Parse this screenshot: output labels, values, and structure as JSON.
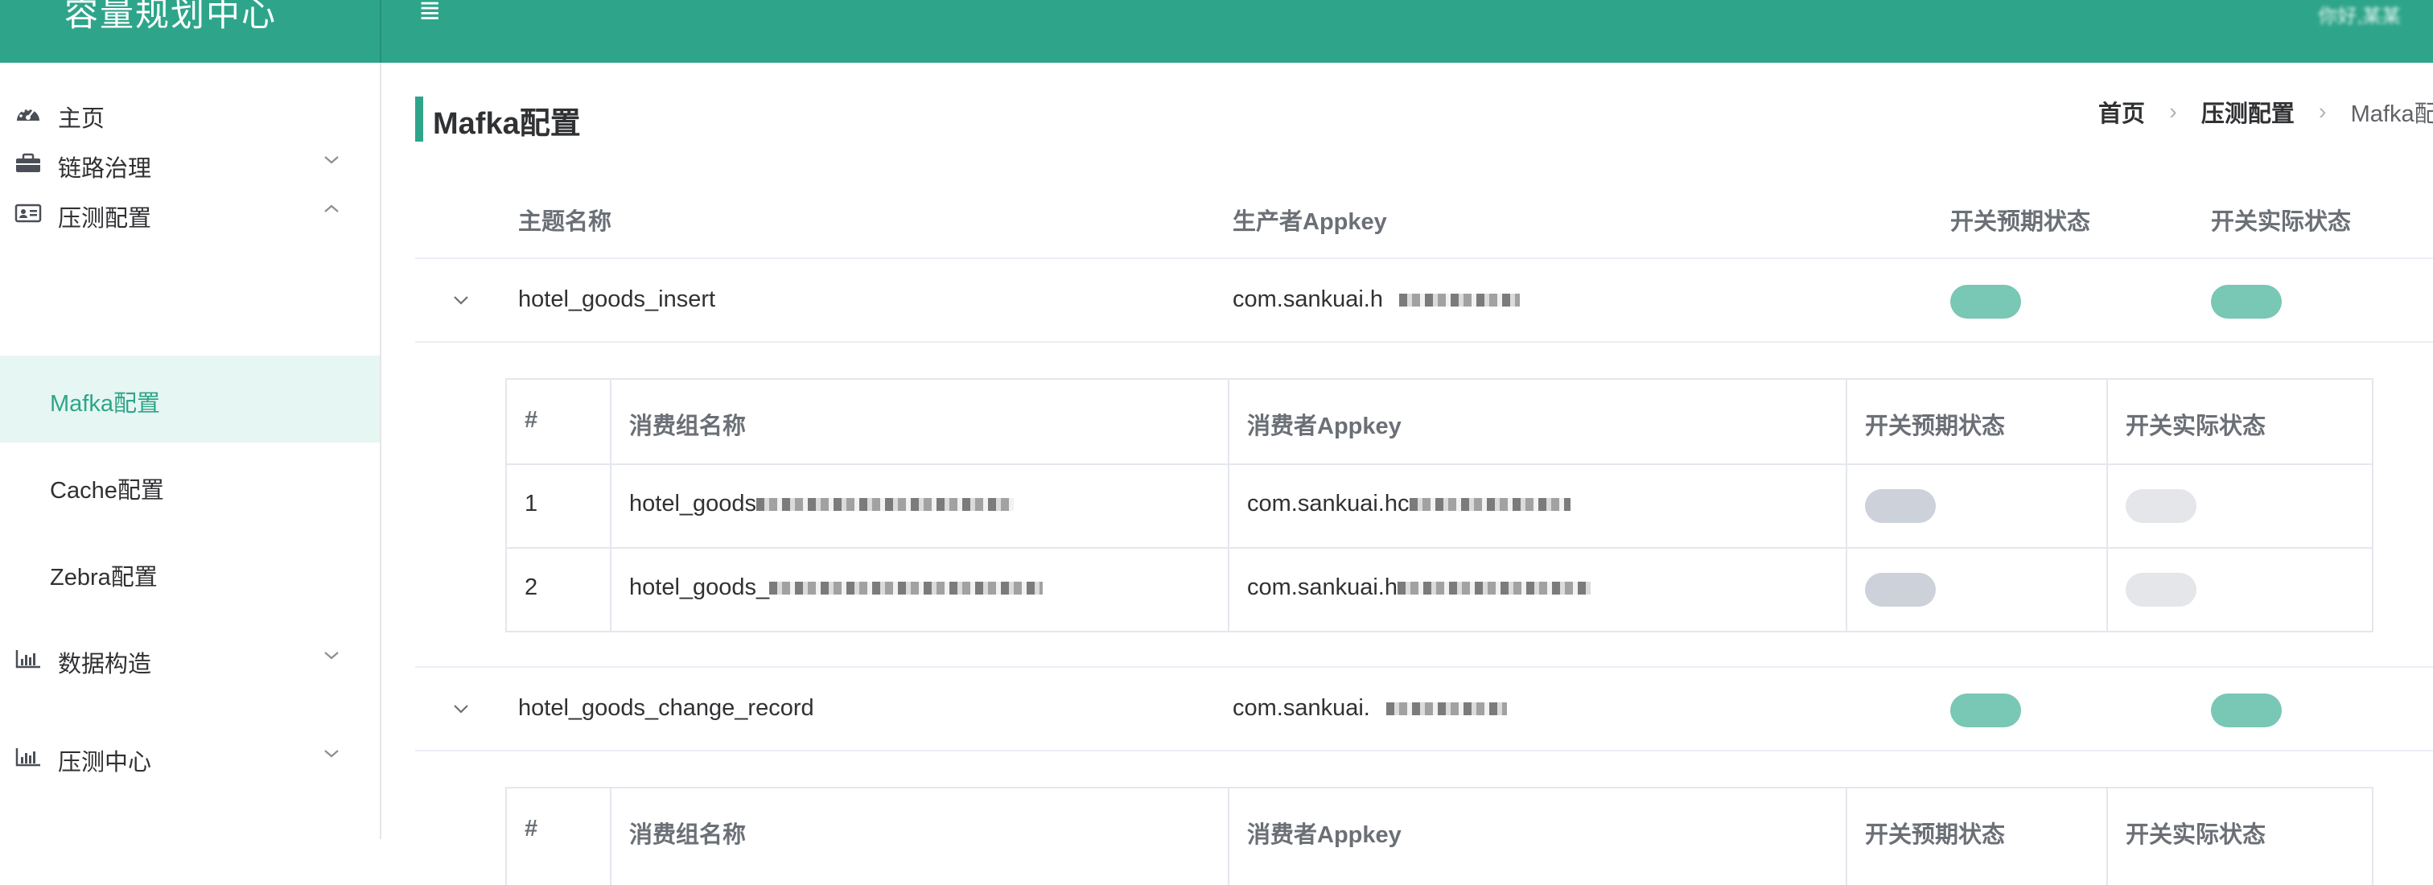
{
  "app": {
    "title": "容量规划中心",
    "menu_icon": "menu-icon",
    "user_name": "你好,某某"
  },
  "sidebar": {
    "items": [
      {
        "label": "主页",
        "icon": "dashboard-icon"
      },
      {
        "label": "链路治理",
        "icon": "briefcase-icon",
        "expanded": false
      },
      {
        "label": "压测配置",
        "icon": "id-card-icon",
        "expanded": true
      },
      {
        "label": "数据构造",
        "icon": "bar-chart-icon",
        "expanded": false
      },
      {
        "label": "压测中心",
        "icon": "bar-chart-icon",
        "expanded": false
      }
    ],
    "sub_items": [
      {
        "label": "Mafka配置",
        "active": true
      },
      {
        "label": "Cache配置",
        "active": false
      },
      {
        "label": "Zebra配置",
        "active": false
      }
    ]
  },
  "page": {
    "title": "Mafka配置"
  },
  "breadcrumb": [
    "首页",
    "压测配置",
    "Mafka配"
  ],
  "table": {
    "columns": [
      "主题名称",
      "生产者Appkey",
      "开关预期状态",
      "开关实际状态"
    ],
    "rows": [
      {
        "topic": "hotel_goods_insert",
        "producer_appkey": "com.sankuai.h",
        "expected_on": true,
        "actual_on": true,
        "consumers": {
          "columns": [
            "#",
            "消费组名称",
            "消费者Appkey",
            "开关预期状态",
            "开关实际状态"
          ],
          "rows": [
            {
              "index": "1",
              "group": "hotel_goods",
              "appkey": "com.sankuai.hc",
              "expected_on": false,
              "actual_on": false
            },
            {
              "index": "2",
              "group": "hotel_goods_",
              "appkey": "com.sankuai.h",
              "expected_on": false,
              "actual_on": false
            }
          ]
        }
      },
      {
        "topic": "hotel_goods_change_record",
        "producer_appkey": "com.sankuai.",
        "expected_on": true,
        "actual_on": true,
        "consumers": {
          "columns": [
            "#",
            "消费组名称",
            "消费者Appkey",
            "开关预期状态",
            "开关实际状态"
          ]
        }
      }
    ]
  },
  "colors": {
    "primary": "#2ea58a",
    "switch_on": "#79c7b5",
    "switch_off": "#cdd1da",
    "switch_off_light": "#e4e6ea"
  }
}
